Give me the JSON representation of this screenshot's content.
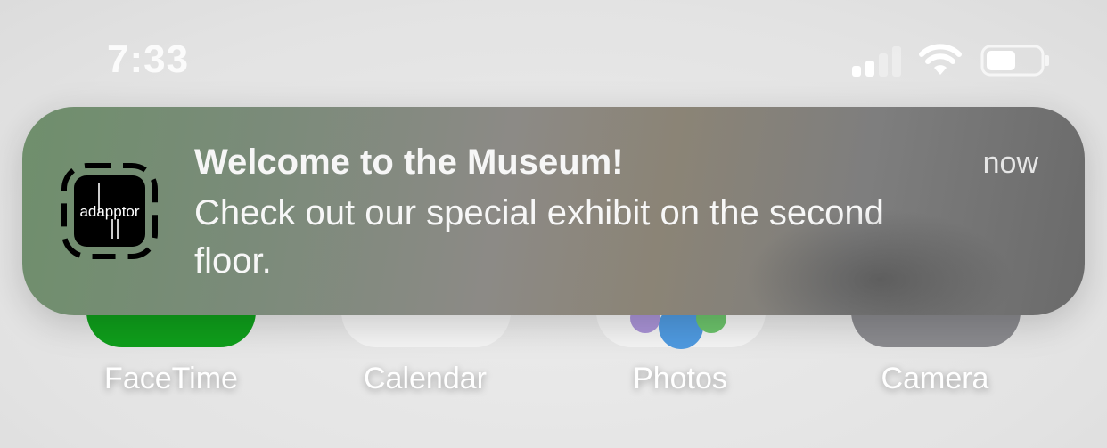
{
  "status_bar": {
    "time": "7:33",
    "icons": [
      "cellular-signal-icon",
      "wifi-icon",
      "battery-icon"
    ]
  },
  "apps": [
    {
      "name": "FaceTime",
      "color": "#0f9e1b"
    },
    {
      "name": "Calendar",
      "color": "#f4f4f4"
    },
    {
      "name": "Photos",
      "color": "#f4f4f4"
    },
    {
      "name": "Camera",
      "color": "#8a8a8e"
    }
  ],
  "notification": {
    "app_icon_text": "adapptor",
    "title": "Welcome to the Museum!",
    "time": "now",
    "body": "Check out our special exhibit on the second floor."
  }
}
